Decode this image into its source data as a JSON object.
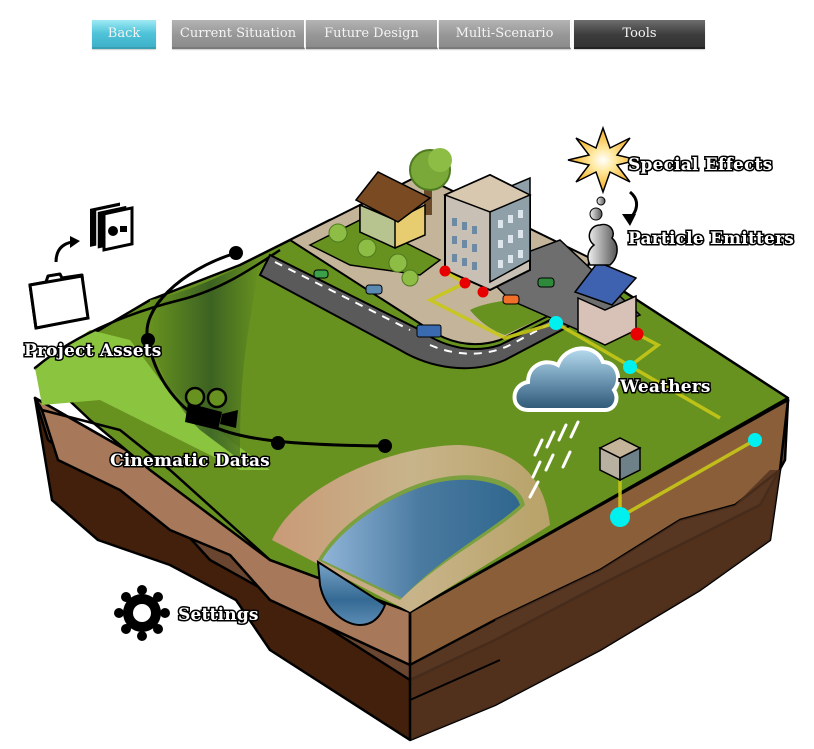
{
  "toolbar": {
    "back_label": "Back",
    "tabs": [
      {
        "label": "Current Situation"
      },
      {
        "label": "Future Design"
      },
      {
        "label": "Multi-Scenario"
      },
      {
        "label": "Tools",
        "active": true
      }
    ]
  },
  "diagram": {
    "labels": {
      "special_effects": "Special Effects",
      "particle_emitters": "Particle Emitters",
      "project_assets": "Project Assets",
      "weathers": "Weathers",
      "cinematic_datas": "Cinematic Datas",
      "settings": "Settings"
    },
    "icons": {
      "special_effects": "explosion-star-icon",
      "particle_emitters": "smoke-puff-icon",
      "project_assets": "folder-to-images-icon",
      "weathers": "rain-cloud-icon",
      "cinematic_datas": "movie-camera-icon",
      "settings": "gear-icon"
    },
    "colors": {
      "grass": "#67921f",
      "grass_light": "#8bc43f",
      "soil_top": "#a8785a",
      "soil_mid": "#6a4630",
      "soil_bottom": "#43200c",
      "road": "#5a5a5a",
      "water": "#3f7196",
      "network_line": "#c8c818",
      "node_cyan": "#00f0f0",
      "node_red": "#e80000",
      "back_button": "#4fc3d8",
      "tools_tab": "#3c3c3c"
    }
  }
}
